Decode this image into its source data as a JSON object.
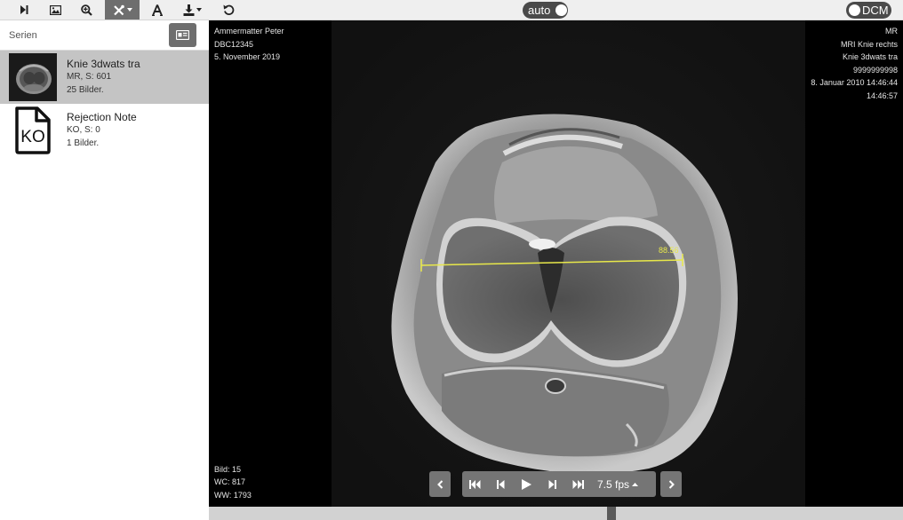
{
  "toolbar": {
    "tools": [
      {
        "name": "next-frame",
        "icon": "skip-next-icon"
      },
      {
        "name": "image",
        "icon": "image-icon"
      },
      {
        "name": "zoom",
        "icon": "zoom-in-icon"
      },
      {
        "name": "measure",
        "icon": "tools-icon",
        "active": true
      },
      {
        "name": "annotate",
        "icon": "text-icon"
      },
      {
        "name": "download",
        "icon": "download-icon"
      },
      {
        "name": "reset",
        "icon": "reset-icon"
      }
    ],
    "auto_label": "auto",
    "dcm_label": "DCM"
  },
  "sidebar": {
    "title": "Serien",
    "items": [
      {
        "name": "Knie 3dwats tra",
        "meta1": "MR, S: 601",
        "meta2": "25 Bilder.",
        "selected": true,
        "icon": "mri-thumbnail"
      },
      {
        "name": "Rejection Note",
        "meta1": "KO, S: 0",
        "meta2": "1 Bilder.",
        "selected": false,
        "icon": "document-icon",
        "icon_text": "KO"
      }
    ]
  },
  "viewer": {
    "top_left": [
      "Ammermatter Peter",
      "DBC12345",
      "5. November 2019"
    ],
    "top_right": [
      "MR",
      "MRI Knie rechts",
      "Knie 3dwats tra",
      "9999999998",
      "8. Januar 2010 14:46:44",
      "14:46:57"
    ],
    "bottom_left": [
      "Bild: 15",
      "WC: 817",
      "WW: 1793"
    ],
    "measurement": "88.56",
    "measurement_color": "#e8e84a"
  },
  "player": {
    "fps_label": "7.5 fps"
  },
  "colors": {
    "toolbar_bg": "#efefef",
    "active_tool_bg": "#6e6e6e",
    "selected_item_bg": "#c4c4c4",
    "player_bg": "#757575"
  }
}
